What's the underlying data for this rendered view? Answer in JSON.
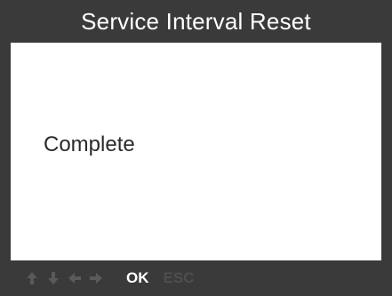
{
  "screen": {
    "title": "Service Interval Reset",
    "message": "Complete"
  },
  "footer": {
    "nav_icons": [
      "up-arrow-icon",
      "down-arrow-icon",
      "left-arrow-icon",
      "right-arrow-icon"
    ],
    "ok_label": "OK",
    "esc_label": "ESC",
    "esc_enabled": false
  },
  "colors": {
    "bar_background": "#3a3a3a",
    "title_text": "#ffffff",
    "body_background": "#ffffff",
    "body_text": "#2a2a2a",
    "nav_icon": "#5a5a5a",
    "ok_text": "#ffffff",
    "esc_text_disabled": "#4e4e4e"
  }
}
